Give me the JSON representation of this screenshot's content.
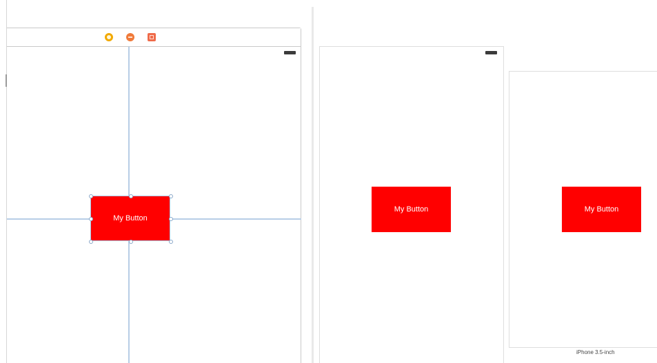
{
  "editor": {
    "scene": {
      "dock_icons": [
        "view-controller-icon",
        "first-responder-icon",
        "exit-icon"
      ],
      "status_bar_icon": "battery-icon",
      "button": {
        "label": "My Button",
        "background": "#ff0000",
        "text_color": "#ffffff"
      },
      "guide_color": "#b7cde6"
    }
  },
  "preview": {
    "devices": [
      {
        "status_bar_icon": "battery-icon",
        "button_label": "My Button",
        "caption": ""
      },
      {
        "button_label": "My Button",
        "caption": "iPhone 3.5-inch"
      }
    ]
  }
}
